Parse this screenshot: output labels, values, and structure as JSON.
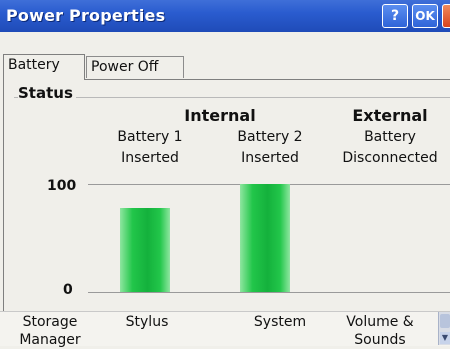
{
  "window": {
    "title": "Power Properties",
    "help_label": "?",
    "ok_label": "OK",
    "close_label": "×"
  },
  "tabs": [
    {
      "label": "Battery",
      "selected": true
    },
    {
      "label": "Power Off",
      "selected": false
    }
  ],
  "status": {
    "group_label": "Status",
    "internal_header": "Internal",
    "external_header": "External",
    "battery1": {
      "name": "Battery 1",
      "state": "Inserted",
      "level_percent": 78
    },
    "battery2": {
      "name": "Battery 2",
      "state": "Inserted",
      "level_percent": 100
    },
    "external": {
      "name": "Battery",
      "state": "Disconnected"
    },
    "axis_max": "100",
    "axis_min": "0"
  },
  "applets": [
    {
      "label": "Storage\nManager"
    },
    {
      "label": "Stylus"
    },
    {
      "label": "System"
    },
    {
      "label": "Volume &\nSounds"
    }
  ],
  "colors": {
    "titlebar": "#2a5ccf",
    "bar_green": "#14b13c"
  }
}
